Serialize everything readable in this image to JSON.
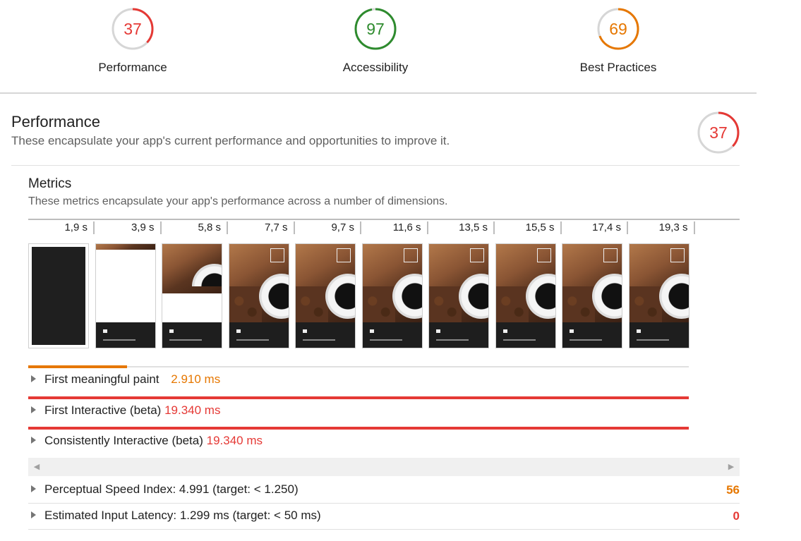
{
  "colors": {
    "fail": "#e53935",
    "average": "#e67700",
    "pass": "#2e8b2e",
    "track": "#d6d6d6"
  },
  "summary_gauges": [
    {
      "score": "37",
      "label": "Performance",
      "fraction": 0.37,
      "status": "fail"
    },
    {
      "score": "97",
      "label": "Accessibility",
      "fraction": 0.97,
      "status": "pass"
    },
    {
      "score": "69",
      "label": "Best Practices",
      "fraction": 0.69,
      "status": "average"
    }
  ],
  "performance": {
    "title": "Performance",
    "description": "These encapsulate your app's current performance and opportunities to improve it.",
    "score": "37",
    "fraction": 0.37
  },
  "metrics": {
    "title": "Metrics",
    "description": "These metrics encapsulate your app's performance across a number of dimensions.",
    "timeline_ticks": [
      "1,9 s",
      "3,9 s",
      "5,8 s",
      "7,7 s",
      "9,7 s",
      "11,6 s",
      "13,5 s",
      "15,5 s",
      "17,4 s",
      "19,3 s"
    ],
    "filmstrip_states": [
      "blank-dark",
      "header-only",
      "partial",
      "full",
      "full",
      "full",
      "full",
      "full",
      "full",
      "full"
    ],
    "rows": [
      {
        "label": "First meaningful paint",
        "value": "2.910 ms",
        "status": "average",
        "fraction": 0.15
      },
      {
        "label": "First Interactive (beta)",
        "value": "19.340 ms",
        "status": "fail",
        "fraction": 1.0
      },
      {
        "label": "Consistently Interactive (beta)",
        "value": "19.340 ms",
        "status": "fail",
        "fraction": 1.0
      }
    ]
  },
  "scrollbar": {
    "left_arrow": "◀",
    "right_arrow": "▶"
  },
  "audits": [
    {
      "label": "Perceptual Speed Index: 4.991 (target: < 1.250)",
      "score": "56",
      "status": "average"
    },
    {
      "label": "Estimated Input Latency: 1.299 ms (target: < 50 ms)",
      "score": "0",
      "status": "fail"
    }
  ]
}
